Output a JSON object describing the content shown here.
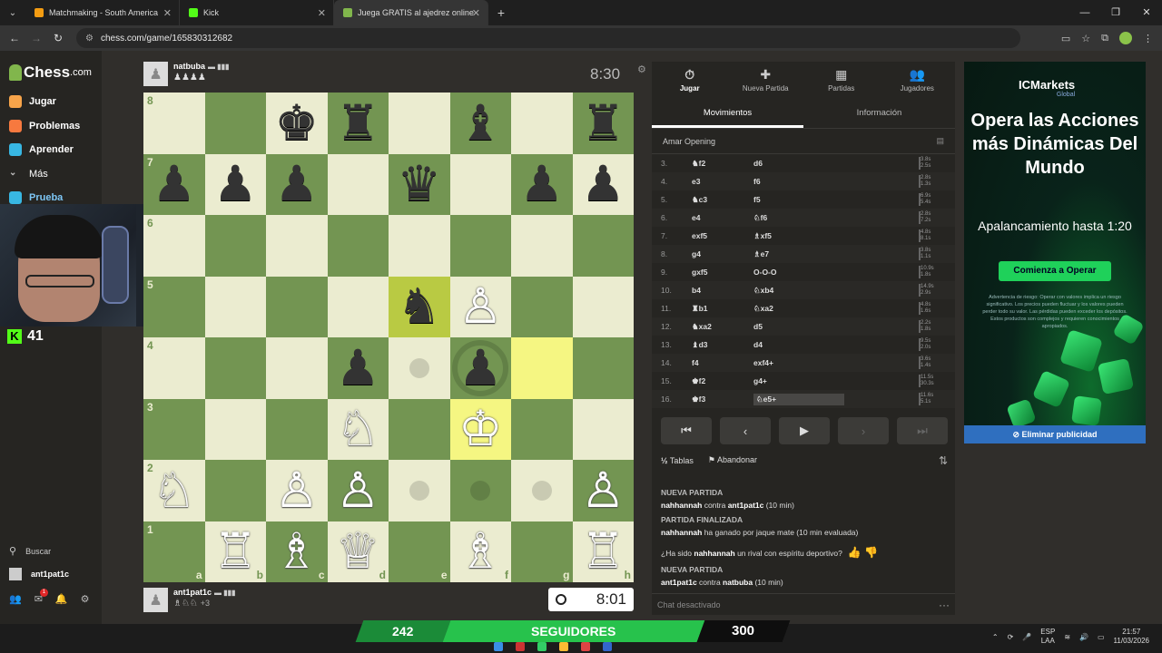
{
  "browser": {
    "tabs": [
      {
        "title": "Matchmaking - South America",
        "fav": "#f39c12"
      },
      {
        "title": "Kick",
        "fav": "#53fc18"
      },
      {
        "title": "Juega GRATIS al ajedrez online",
        "fav": "#81b64c"
      }
    ],
    "url": "chess.com/game/165830312682"
  },
  "sidebar": {
    "logo_main": "Chess",
    "logo_suffix": ".com",
    "items": [
      {
        "label": "Jugar",
        "color": "#f7a44a"
      },
      {
        "label": "Problemas",
        "color": "#f7793f"
      },
      {
        "label": "Aprender",
        "color": "#38b7e3"
      },
      {
        "label": "Más",
        "color": "#888"
      },
      {
        "label": "Prueba",
        "color": "#38b7e3"
      }
    ],
    "search": "Buscar",
    "user": "ant1pat1c",
    "notif_badge": "1"
  },
  "stream": {
    "kick_viewers": "41",
    "followers_current": "242",
    "followers_label": "SEGUIDORES",
    "followers_goal": "300"
  },
  "game": {
    "top_player": {
      "name": "natbuba",
      "captured": "♟♟♟♟",
      "clock": "8:30"
    },
    "bottom_player": {
      "name": "ant1pat1c",
      "captured": "♗♘♘",
      "material": "+3",
      "clock": "8:01"
    },
    "board": [
      [
        "",
        "",
        "♚",
        "♜",
        "",
        "♝",
        "",
        "♜"
      ],
      [
        "♟",
        "♟",
        "♟",
        "",
        "♛",
        "",
        "♟",
        "♟"
      ],
      [
        "",
        "",
        "",
        "",
        "",
        "",
        "",
        ""
      ],
      [
        "",
        "",
        "",
        "",
        "♞",
        "♙",
        "",
        ""
      ],
      [
        "",
        "",
        "",
        "♟",
        "",
        "♟",
        "",
        ""
      ],
      [
        "",
        "",
        "",
        "♘",
        "",
        "♔",
        "",
        ""
      ],
      [
        "♘",
        "",
        "♙",
        "♙",
        "",
        "",
        "",
        "♙"
      ],
      [
        "",
        "♖",
        "♗",
        "♕",
        "",
        "♗",
        "",
        "♖"
      ]
    ],
    "ranks": [
      "8",
      "7",
      "6",
      "5",
      "4",
      "3",
      "2",
      "1"
    ],
    "files": [
      "a",
      "b",
      "c",
      "d",
      "e",
      "f",
      "g",
      "h"
    ]
  },
  "panel": {
    "tabs": [
      {
        "label": "Jugar",
        "icon": "⏱"
      },
      {
        "label": "Nueva Partida",
        "icon": "✚"
      },
      {
        "label": "Partidas",
        "icon": "▦"
      },
      {
        "label": "Jugadores",
        "icon": "👥"
      }
    ],
    "subtabs": [
      "Movimientos",
      "Información"
    ],
    "opening": "Amar Opening",
    "moves": [
      {
        "n": "3.",
        "w": "♞f2",
        "b": "d6",
        "t1": "3.8s",
        "t2": "2.5s"
      },
      {
        "n": "4.",
        "w": "e3",
        "b": "f6",
        "t1": "2.8s",
        "t2": "1.3s"
      },
      {
        "n": "5.",
        "w": "♞c3",
        "b": "f5",
        "t1": "6.9s",
        "t2": "5.4s"
      },
      {
        "n": "6.",
        "w": "e4",
        "b": "♘f6",
        "t1": "2.8s",
        "t2": "7.2s"
      },
      {
        "n": "7.",
        "w": "exf5",
        "b": "♗xf5",
        "t1": "4.8s",
        "t2": "8.1s"
      },
      {
        "n": "8.",
        "w": "g4",
        "b": "♗e7",
        "t1": "3.8s",
        "t2": "1.1s"
      },
      {
        "n": "9.",
        "w": "gxf5",
        "b": "O-O-O",
        "t1": "10.9s",
        "t2": "1.8s"
      },
      {
        "n": "10.",
        "w": "b4",
        "b": "♘xb4",
        "t1": "14.9s",
        "t2": "2.9s"
      },
      {
        "n": "11.",
        "w": "♜b1",
        "b": "♘xa2",
        "t1": "4.8s",
        "t2": "1.6s"
      },
      {
        "n": "12.",
        "w": "♞xa2",
        "b": "d5",
        "t1": "2.2s",
        "t2": "1.8s"
      },
      {
        "n": "13.",
        "w": "♝d3",
        "b": "d4",
        "t1": "9.5s",
        "t2": "2.0s"
      },
      {
        "n": "14.",
        "w": "f4",
        "b": "exf4+",
        "t1": "3.6s",
        "t2": "1.4s"
      },
      {
        "n": "15.",
        "w": "♚f2",
        "b": "g4+",
        "t1": "11.5s",
        "t2": "30.3s"
      },
      {
        "n": "16.",
        "w": "♚f3",
        "b": "♘e5+",
        "t1": "11.6s",
        "t2": "5.1s"
      }
    ],
    "draw_label": "Tablas",
    "draw_icon": "½",
    "resign_label": "Abandonar",
    "log": [
      {
        "header": "NUEVA PARTIDA",
        "pre": "",
        "b1": "nahhannah",
        "mid": " contra ",
        "b2": "ant1pat1c",
        "post": " (10 min)"
      },
      {
        "header": "PARTIDA FINALIZADA",
        "pre": "",
        "b1": "nahhannah",
        "mid": " ha ganado por jaque mate (10 min evaluada)",
        "b2": "",
        "post": ""
      },
      {
        "header": "",
        "pre": "¿Ha sido ",
        "b1": "nahhannah",
        "mid": " un rival con espíritu deportivo?",
        "b2": "",
        "post": ""
      },
      {
        "header": "NUEVA PARTIDA",
        "pre": "",
        "b1": "ant1pat1c",
        "mid": " contra ",
        "b2": "natbuba",
        "post": " (10 min)"
      }
    ],
    "chat_disabled": "Chat desactivado"
  },
  "ad": {
    "brand": "ICMarkets",
    "brand_sub": "Global",
    "title": "Opera las Acciones más Dinámicas Del Mundo",
    "subtitle": "Apalancamiento hasta 1:20",
    "cta": "Comienza a Operar",
    "warning": "Advertencia de riesgo: Operar con valores implica un riesgo significativo. Los precios pueden fluctuar y los valores pueden perder todo su valor. Las pérdidas pueden exceder los depósitos. Estos productos son complejos y requieren conocimientos apropiados.",
    "remove": "Eliminar publicidad"
  },
  "taskbar": {
    "lang": "ESP",
    "lang2": "LAA",
    "time": "21:57",
    "date": "11/03/2026"
  }
}
